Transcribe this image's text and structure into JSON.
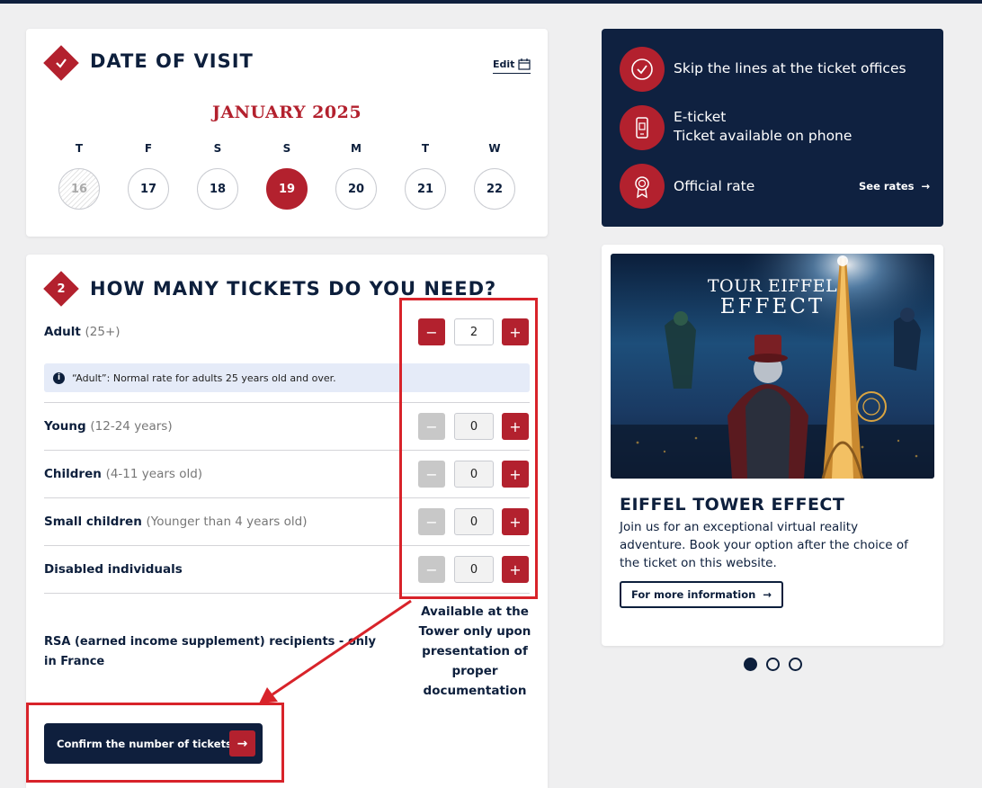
{
  "colors": {
    "brand_red": "#b3212e",
    "navy": "#0f1f3d",
    "annotation_red": "#d8232a"
  },
  "date_section": {
    "title": "DATE OF VISIT",
    "edit_label": "Edit",
    "month": "JANUARY 2025",
    "days": [
      {
        "letter": "T",
        "number": "16",
        "state": "disabled"
      },
      {
        "letter": "F",
        "number": "17",
        "state": "normal"
      },
      {
        "letter": "S",
        "number": "18",
        "state": "normal"
      },
      {
        "letter": "S",
        "number": "19",
        "state": "selected"
      },
      {
        "letter": "M",
        "number": "20",
        "state": "normal"
      },
      {
        "letter": "T",
        "number": "21",
        "state": "normal"
      },
      {
        "letter": "W",
        "number": "22",
        "state": "normal"
      }
    ]
  },
  "tickets_section": {
    "step_number": "2",
    "title": "HOW MANY TICKETS DO YOU NEED?",
    "minus_symbol": "−",
    "plus_symbol": "+",
    "info_icon": "i",
    "info_text": "“Adult”: Normal rate for adults 25 years old and over.",
    "rows": [
      {
        "label": "Adult",
        "sub": "(25+)",
        "quantity": "2"
      },
      {
        "label": "Young",
        "sub": "(12-24 years)",
        "quantity": "0"
      },
      {
        "label": "Children",
        "sub": "(4-11 years old)",
        "quantity": "0"
      },
      {
        "label": "Small children",
        "sub": "(Younger than 4 years old)",
        "quantity": "0"
      },
      {
        "label": "Disabled individuals",
        "sub": "",
        "quantity": "0"
      }
    ],
    "rsa_label": "RSA (earned income supplement) recipients - only in France",
    "availability_note": "Available at the Tower only upon presentation of proper documentation",
    "confirm_label": "Confirm the number of tickets",
    "confirm_arrow": "→"
  },
  "benefits": {
    "items": [
      {
        "icon": "check-circle-icon",
        "lines": [
          "Skip the lines at the ticket offices"
        ]
      },
      {
        "icon": "phone-ticket-icon",
        "lines": [
          "E-ticket",
          "Ticket available on phone"
        ]
      },
      {
        "icon": "award-ribbon-icon",
        "lines": [
          "Official rate"
        ]
      }
    ],
    "see_rates_label": "See rates",
    "arrow": "→"
  },
  "promo": {
    "image_logo_text": [
      "TOUR EIFFEL",
      "EFFECT"
    ],
    "title": "EIFFEL TOWER EFFECT",
    "description": "Join us for an exceptional virtual reality adventure. Book your option after the choice of the ticket on this website.",
    "button_label": "For more information",
    "arrow": "→",
    "carousel_active_index": 0,
    "carousel_count": 3
  }
}
